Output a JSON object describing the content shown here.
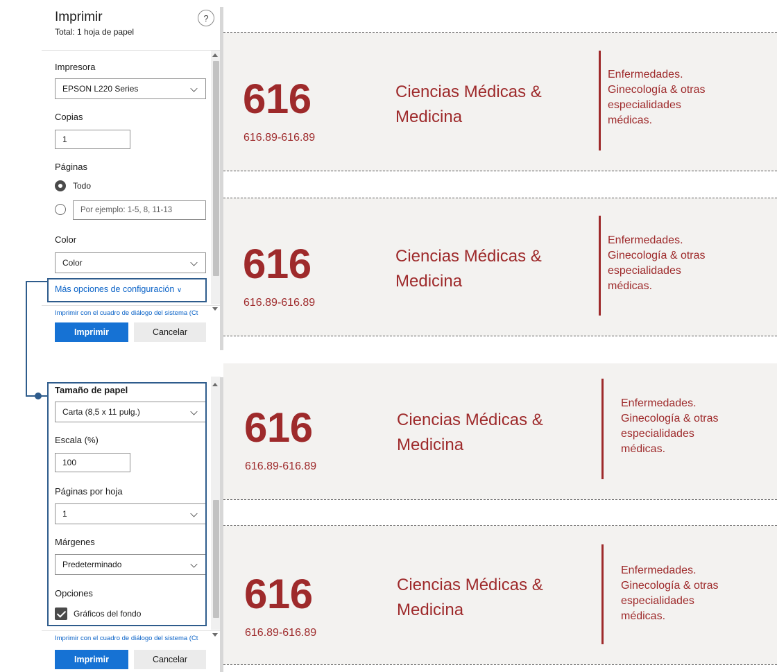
{
  "dialog": {
    "title": "Imprimir",
    "subtitle": "Total: 1 hoja de papel",
    "help_label": "?",
    "printer_label": "Impresora",
    "printer_value": "EPSON L220 Series",
    "copies_label": "Copias",
    "copies_value": "1",
    "pages_label": "Páginas",
    "pages_all_label": "Todo",
    "pages_range_placeholder": "Por ejemplo: 1-5, 8, 11-13",
    "color_label": "Color",
    "color_value": "Color",
    "more_settings_label": "Más opciones de configuración",
    "system_dialog_link": "Imprimir con el cuadro de diálogo del sistema (Ct",
    "print_button": "Imprimir",
    "cancel_button": "Cancelar"
  },
  "dialog_more": {
    "paper_size_label": "Tamaño de papel",
    "paper_size_value": "Carta (8,5 x 11 pulg.)",
    "scale_label": "Escala (%)",
    "scale_value": "100",
    "pages_per_sheet_label": "Páginas por hoja",
    "pages_per_sheet_value": "1",
    "margins_label": "Márgenes",
    "margins_value": "Predeterminado",
    "options_label": "Opciones",
    "background_graphics_label": "Gráficos del fondo",
    "background_graphics_checked": true,
    "system_dialog_link": "Imprimir con el cuadro de diálogo del sistema (Ct",
    "print_button": "Imprimir",
    "cancel_button": "Cancelar"
  },
  "labels": [
    {
      "number": "616",
      "range": "616.89-616.89",
      "category_line1": "Ciencias Médicas &",
      "category_line2": "Medicina",
      "desc_line1": "Enfermedades.",
      "desc_line2": "Ginecología & otras",
      "desc_line3": "especialidades",
      "desc_line4": "médicas."
    },
    {
      "number": "616",
      "range": "616.89-616.89",
      "category_line1": "Ciencias Médicas &",
      "category_line2": "Medicina",
      "desc_line1": "Enfermedades.",
      "desc_line2": "Ginecología & otras",
      "desc_line3": "especialidades",
      "desc_line4": "médicas."
    },
    {
      "number": "616",
      "range": "616.89-616.89",
      "category_line1": "Ciencias Médicas &",
      "category_line2": "Medicina",
      "desc_line1": "Enfermedades.",
      "desc_line2": "Ginecología & otras",
      "desc_line3": "especialidades",
      "desc_line4": "médicas."
    },
    {
      "number": "616",
      "range": "616.89-616.89",
      "category_line1": "Ciencias Médicas &",
      "category_line2": "Medicina",
      "desc_line1": "Enfermedades.",
      "desc_line2": "Ginecología & otras",
      "desc_line3": "especialidades",
      "desc_line4": "médicas."
    }
  ],
  "colors": {
    "accent": "#1672d4",
    "label_text": "#9e2a2b",
    "label_bg": "#f3f2f0",
    "highlight": "#2e5c8c"
  }
}
